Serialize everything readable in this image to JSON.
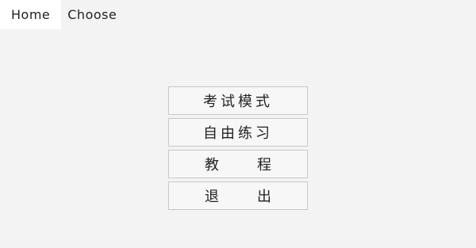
{
  "tabs": [
    {
      "label": "Home",
      "active": true
    },
    {
      "label": "Choose",
      "active": false
    }
  ],
  "menu": {
    "exam_mode": "考试模式",
    "free_practice": "自由练习",
    "tutorial": [
      "教",
      "程"
    ],
    "exit": [
      "退",
      "出"
    ]
  }
}
